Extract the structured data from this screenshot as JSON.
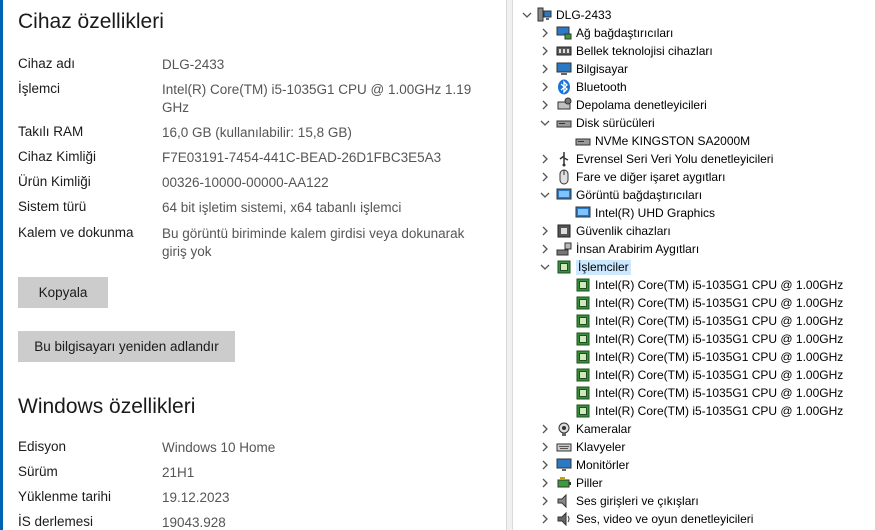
{
  "device_specs": {
    "title": "Cihaz özellikleri",
    "rows": [
      {
        "label": "Cihaz adı",
        "value": "DLG-2433"
      },
      {
        "label": "İşlemci",
        "value": "Intel(R) Core(TM) i5-1035G1 CPU @ 1.00GHz   1.19 GHz"
      },
      {
        "label": "Takılı RAM",
        "value": "16,0 GB (kullanılabilir: 15,8 GB)"
      },
      {
        "label": "Cihaz Kimliği",
        "value": "F7E03191-7454-441C-BEAD-26D1FBC3E5A3"
      },
      {
        "label": "Ürün Kimliği",
        "value": "00326-10000-00000-AA122"
      },
      {
        "label": "Sistem türü",
        "value": "64 bit işletim sistemi, x64 tabanlı işlemci"
      },
      {
        "label": "Kalem ve dokunma",
        "value": "Bu görüntü biriminde kalem girdisi veya dokunarak giriş yok"
      }
    ],
    "copy_button": "Kopyala",
    "rename_button": "Bu bilgisayarı yeniden adlandır"
  },
  "windows_specs": {
    "title": "Windows özellikleri",
    "rows": [
      {
        "label": "Edisyon",
        "value": "Windows 10 Home"
      },
      {
        "label": "Sürüm",
        "value": "21H1"
      },
      {
        "label": "Yüklenme tarihi",
        "value": "19.12.2023"
      },
      {
        "label": "İS derlemesi",
        "value": "19043.928"
      }
    ]
  },
  "device_manager": {
    "root": "DLG-2433",
    "categories": [
      {
        "label": "Ağ bağdaştırıcıları",
        "icon": "network-adapter-icon",
        "expanded": false
      },
      {
        "label": "Bellek teknolojisi cihazları",
        "icon": "memory-device-icon",
        "expanded": false
      },
      {
        "label": "Bilgisayar",
        "icon": "computer-icon",
        "expanded": false
      },
      {
        "label": "Bluetooth",
        "icon": "bluetooth-icon",
        "expanded": false
      },
      {
        "label": "Depolama denetleyicileri",
        "icon": "storage-controller-icon",
        "expanded": false
      },
      {
        "label": "Disk sürücüleri",
        "icon": "disk-drive-icon",
        "expanded": true,
        "children": [
          "NVMe KINGSTON SA2000M"
        ]
      },
      {
        "label": "Evrensel Seri Veri Yolu denetleyicileri",
        "icon": "usb-icon",
        "expanded": false
      },
      {
        "label": "Fare ve diğer işaret aygıtları",
        "icon": "mouse-icon",
        "expanded": false
      },
      {
        "label": "Görüntü bağdaştırıcıları",
        "icon": "display-adapter-icon",
        "expanded": true,
        "children": [
          "Intel(R) UHD Graphics"
        ]
      },
      {
        "label": "Güvenlik cihazları",
        "icon": "security-device-icon",
        "expanded": false
      },
      {
        "label": "İnsan Arabirim Aygıtları",
        "icon": "hid-icon",
        "expanded": false
      },
      {
        "label": "İşlemciler",
        "icon": "processor-icon",
        "expanded": true,
        "selected": true,
        "children": [
          "Intel(R) Core(TM) i5-1035G1 CPU @ 1.00GHz",
          "Intel(R) Core(TM) i5-1035G1 CPU @ 1.00GHz",
          "Intel(R) Core(TM) i5-1035G1 CPU @ 1.00GHz",
          "Intel(R) Core(TM) i5-1035G1 CPU @ 1.00GHz",
          "Intel(R) Core(TM) i5-1035G1 CPU @ 1.00GHz",
          "Intel(R) Core(TM) i5-1035G1 CPU @ 1.00GHz",
          "Intel(R) Core(TM) i5-1035G1 CPU @ 1.00GHz",
          "Intel(R) Core(TM) i5-1035G1 CPU @ 1.00GHz"
        ]
      },
      {
        "label": "Kameralar",
        "icon": "camera-icon",
        "expanded": false
      },
      {
        "label": "Klavyeler",
        "icon": "keyboard-icon",
        "expanded": false
      },
      {
        "label": "Monitörler",
        "icon": "monitor-icon",
        "expanded": false
      },
      {
        "label": "Piller",
        "icon": "battery-icon",
        "expanded": false
      },
      {
        "label": "Ses girişleri ve çıkışları",
        "icon": "audio-io-icon",
        "expanded": false
      },
      {
        "label": "Ses, video ve oyun denetleyicileri",
        "icon": "sound-controller-icon",
        "expanded": false
      }
    ]
  },
  "colors": {
    "accent": "#0063b1",
    "selection": "#cce8ff",
    "button": "#cccccc"
  }
}
